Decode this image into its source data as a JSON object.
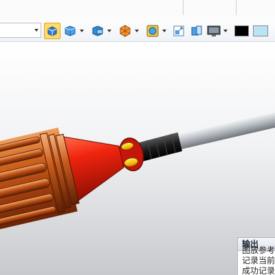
{
  "toolbar": {
    "icons": [
      "view-orient-icon",
      "shaded-cube-icon",
      "section-view-icon",
      "shaded-with-edges-icon",
      "hide-show-icon",
      "zoom-fit-icon",
      "appearance-icon",
      "display-monitor-icon"
    ],
    "swatches": [
      "#000000",
      "#b8e4f4"
    ]
  },
  "output_panel": {
    "title": "输出",
    "lines": [
      "图放参考",
      "记录当前",
      "成功记录"
    ]
  },
  "colors": {
    "handle": "#c4581c",
    "cone": "#e02a12",
    "ferrule": "#ffcc1a",
    "shaft": "#c9cdd1",
    "grip": "#1f1f1f"
  }
}
